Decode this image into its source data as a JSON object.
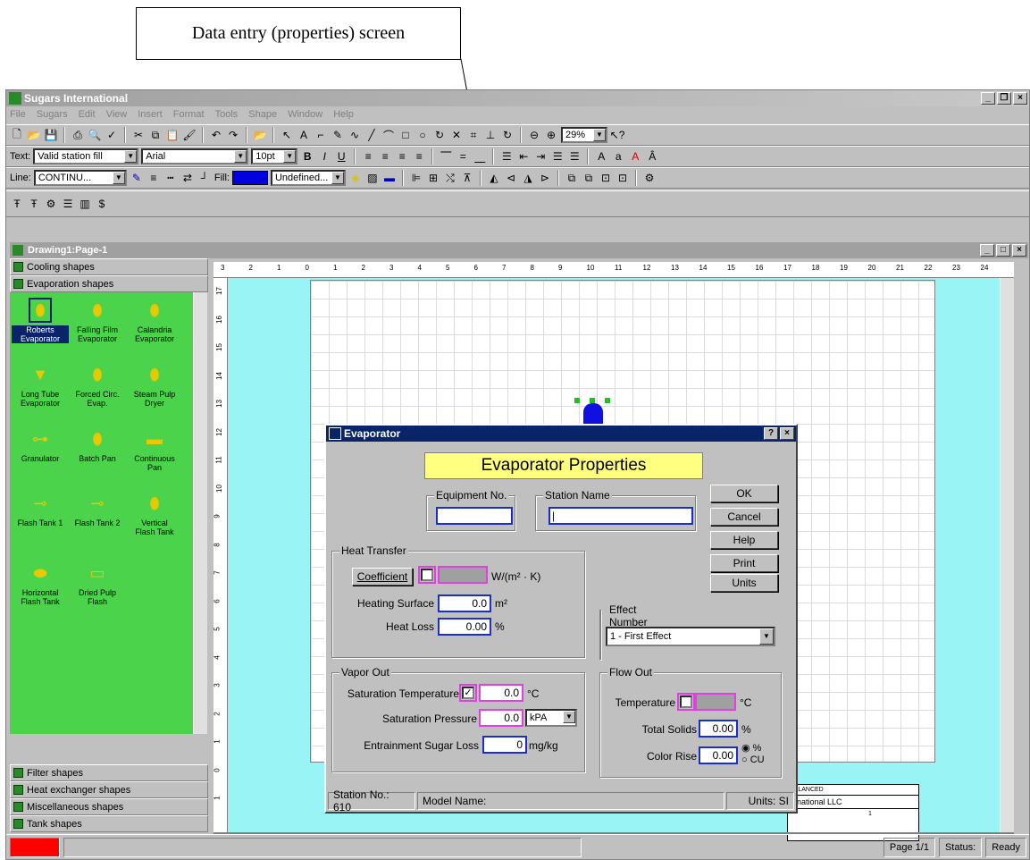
{
  "annotation": "Data entry (properties) screen",
  "app": {
    "title": "Sugars International",
    "menus": [
      "File",
      "Sugars",
      "Edit",
      "View",
      "Insert",
      "Format",
      "Tools",
      "Shape",
      "Window",
      "Help"
    ],
    "text_style": "Valid station fill",
    "font": "Arial",
    "font_size": "10pt",
    "zoom": "29%",
    "line_style": "CONTINU...",
    "fill_label": "Fill:",
    "fill_style": "Undefined...",
    "text_label": "Text:",
    "line_label": "Line:"
  },
  "drawing": {
    "title": "Drawing1:Page-1",
    "ruler_h": [
      "3",
      "2",
      "1",
      "0",
      "1",
      "2",
      "3",
      "4",
      "5",
      "6",
      "7",
      "8",
      "9",
      "10",
      "11",
      "12",
      "13",
      "14",
      "15",
      "16",
      "17",
      "18",
      "19",
      "20",
      "21",
      "22",
      "23",
      "24"
    ],
    "ruler_v": [
      "17",
      "16",
      "15",
      "14",
      "13",
      "12",
      "11",
      "10",
      "9",
      "8",
      "7",
      "6",
      "5",
      "4",
      "3",
      "2",
      "1",
      "0",
      "1"
    ],
    "title_block": [
      "BALANCED",
      "ernational LLC",
      "1"
    ]
  },
  "stencil": {
    "top_cats": [
      "Cooling shapes",
      "Evaporation shapes"
    ],
    "bottom_cats": [
      "Filter shapes",
      "Heat exchanger shapes",
      "Miscellaneous shapes",
      "Tank shapes"
    ],
    "shapes": [
      {
        "l1": "Roberts",
        "l2": "Evaporator"
      },
      {
        "l1": "Falling Film",
        "l2": "Evaporator"
      },
      {
        "l1": "Calandria",
        "l2": "Evaporator"
      },
      {
        "l1": "Long Tube",
        "l2": "Evaporator"
      },
      {
        "l1": "Forced Circ.",
        "l2": "Evap."
      },
      {
        "l1": "Steam Pulp",
        "l2": "Dryer"
      },
      {
        "l1": "Granulator",
        "l2": ""
      },
      {
        "l1": "Batch Pan",
        "l2": ""
      },
      {
        "l1": "Continuous",
        "l2": "Pan"
      },
      {
        "l1": "Flash Tank 1",
        "l2": ""
      },
      {
        "l1": "Flash Tank 2",
        "l2": ""
      },
      {
        "l1": "Vertical",
        "l2": "Flash Tank"
      },
      {
        "l1": "Horizontal",
        "l2": "Flash Tank"
      },
      {
        "l1": "Dried Pulp",
        "l2": "Flash"
      }
    ]
  },
  "status": {
    "page": "Page 1/1",
    "status_label": "Status:",
    "status_value": "Ready"
  },
  "dialog": {
    "title": "Evaporator",
    "header": "Evaporator Properties",
    "equipment_no_label": "Equipment No.",
    "station_name_label": "Station Name",
    "ok": "OK",
    "cancel": "Cancel",
    "help": "Help",
    "print": "Print",
    "units": "Units",
    "heat_transfer": "Heat Transfer",
    "coefficient": "Coefficient",
    "coeff_unit": "W/(m² · K)",
    "heating_surface_label": "Heating Surface",
    "heating_surface": "0.0",
    "heating_surface_unit": "m²",
    "heat_loss_label": "Heat Loss",
    "heat_loss": "0.00",
    "heat_loss_unit": "%",
    "effect_number_label": "Effect Number",
    "effect_number": "1 - First Effect",
    "vapor_out": "Vapor Out",
    "sat_temp_label": "Saturation Temperature",
    "sat_temp": "0.0",
    "sat_temp_unit": "°C",
    "sat_pres_label": "Saturation Pressure",
    "sat_pres": "0.0",
    "sat_pres_unit": "kPA",
    "entrain_label": "Entrainment Sugar Loss",
    "entrain": "0",
    "entrain_unit": "mg/kg",
    "flow_out": "Flow Out",
    "temp_label": "Temperature",
    "temp_unit": "°C",
    "solids_label": "Total Solids",
    "solids": "0.00",
    "solids_unit": "%",
    "color_label": "Color Rise",
    "color": "0.00",
    "color_opt1": "%",
    "color_opt2": "CU",
    "station_no": "Station No.: 610",
    "model_name": "Model Name:",
    "units_status": "Units: SI"
  }
}
